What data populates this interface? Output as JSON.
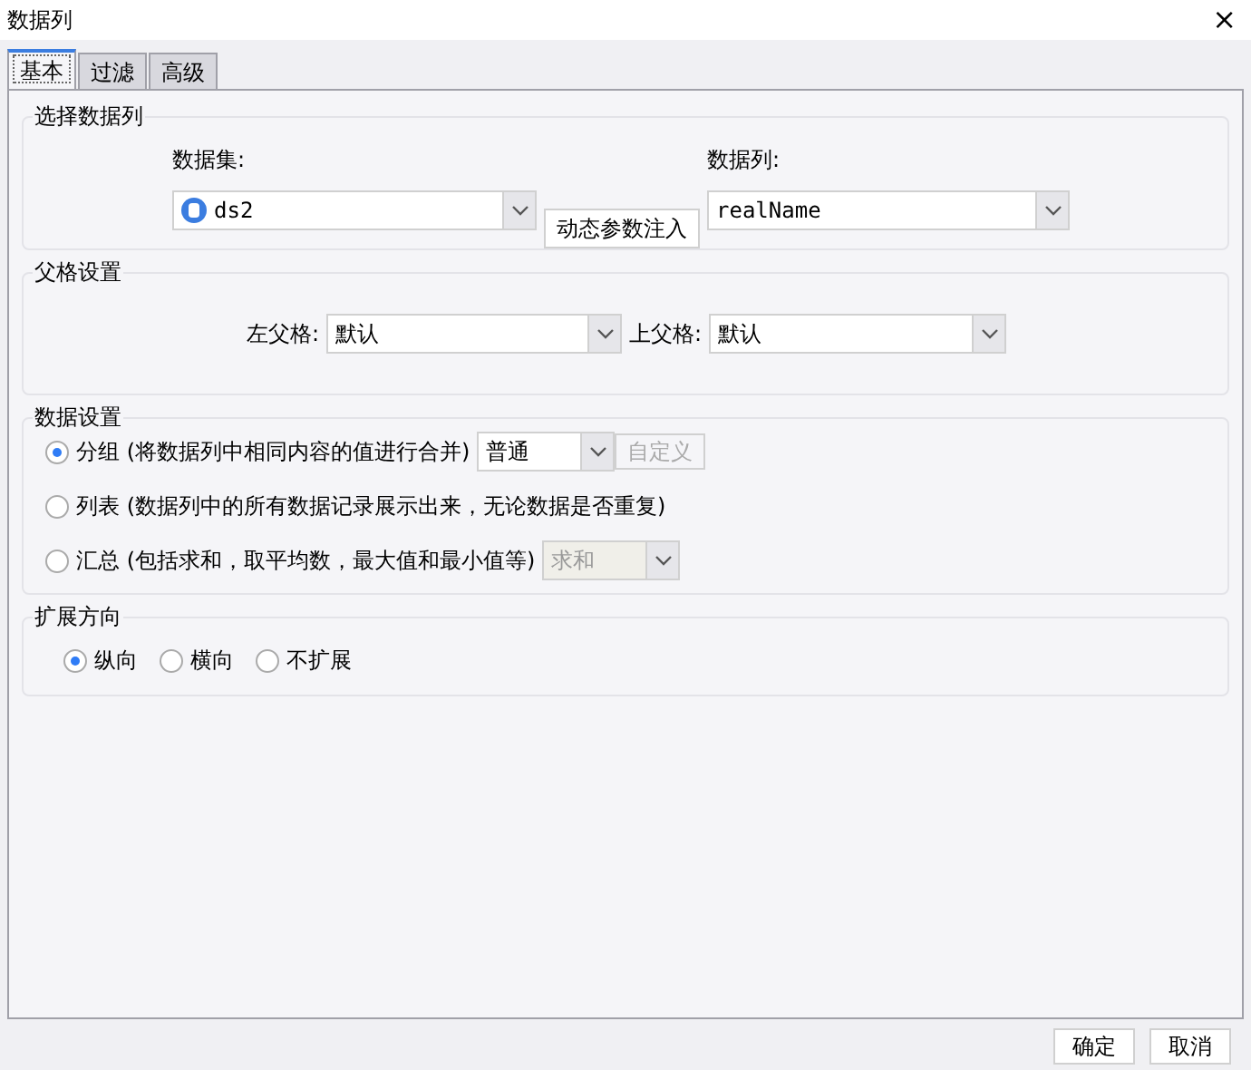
{
  "window": {
    "title": "数据列",
    "close": "×"
  },
  "tabs": [
    {
      "label": "基本",
      "selected": true
    },
    {
      "label": "过滤",
      "selected": false
    },
    {
      "label": "高级",
      "selected": false
    }
  ],
  "select_column": {
    "title": "选择数据列",
    "dataset_label": "数据集:",
    "dataset_value": "ds2",
    "inject_button": "动态参数注入",
    "column_label": "数据列:",
    "column_value": "realName"
  },
  "parent": {
    "title": "父格设置",
    "left_label": "左父格:",
    "left_value": "默认",
    "up_label": "上父格:",
    "up_value": "默认"
  },
  "data_settings": {
    "title": "数据设置",
    "options": [
      {
        "label": "分组 (将数据列中相同内容的值进行合并)",
        "selected": true,
        "select": {
          "value": "普通",
          "disabled": false
        },
        "button": {
          "label": "自定义",
          "disabled": true
        }
      },
      {
        "label": "列表 (数据列中的所有数据记录展示出来，无论数据是否重复)",
        "selected": false
      },
      {
        "label": "汇总 (包括求和，取平均数，最大值和最小值等)",
        "selected": false,
        "select": {
          "value": "求和",
          "disabled": true
        }
      }
    ]
  },
  "expand": {
    "title": "扩展方向",
    "options": [
      {
        "label": "纵向",
        "selected": true
      },
      {
        "label": "横向",
        "selected": false
      },
      {
        "label": "不扩展",
        "selected": false
      }
    ]
  },
  "buttons": [
    "确定",
    "取消"
  ]
}
